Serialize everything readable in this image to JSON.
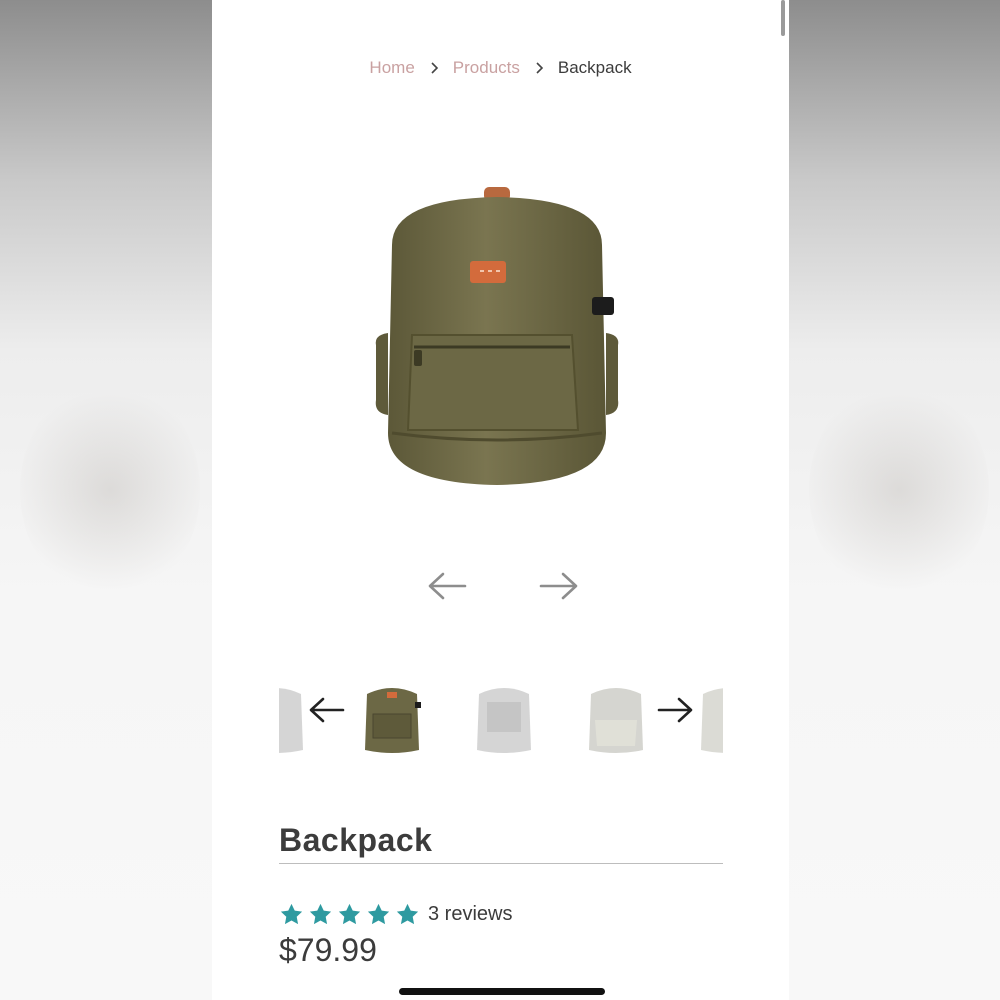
{
  "breadcrumb": {
    "home": "Home",
    "products": "Products",
    "current": "Backpack"
  },
  "icons": {
    "breadcrumb_separator": "chevron-right-icon",
    "image_prev": "arrow-left-icon",
    "image_next": "arrow-right-icon",
    "thumb_prev": "arrow-left-icon",
    "thumb_next": "arrow-right-icon",
    "rating": "star-icon"
  },
  "product": {
    "title": "Backpack",
    "rating": 5,
    "rating_max": 5,
    "reviews": "3 reviews",
    "price": "$79.99"
  },
  "colors": {
    "accent": "#2e9aa0",
    "link": "#c9a1a1",
    "text": "#3c3c3c",
    "bag_olive": "#6f6a45",
    "patch_orange": "#d36b3c"
  }
}
